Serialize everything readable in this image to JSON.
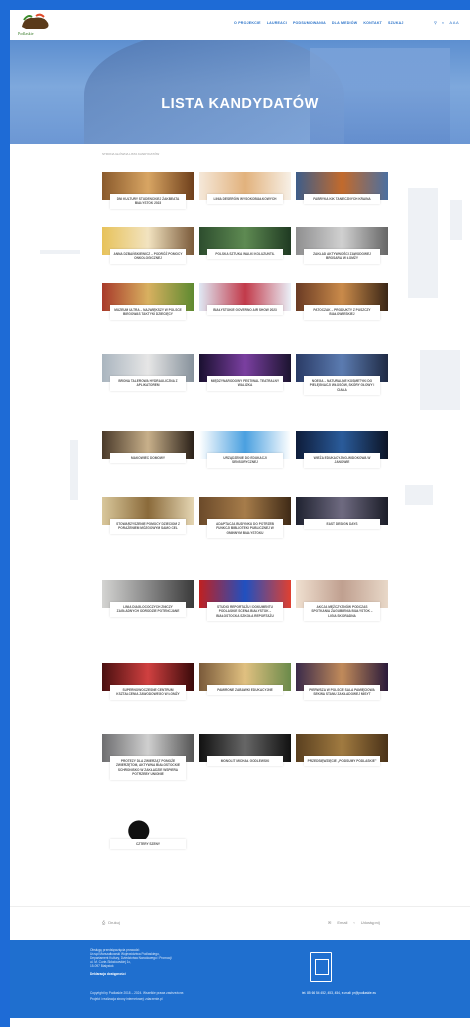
{
  "header": {
    "logo_text": "Podlaskie",
    "nav": [
      "O PROJEKCIE",
      "LAUREACI",
      "PODSUMOWANIA",
      "DLA MEDIÓW",
      "KONTAKT",
      "SZUKAJ"
    ],
    "lang": "A A A"
  },
  "hero": {
    "title": "LISTA KANDYDATÓW"
  },
  "breadcrumb": "STRONA GŁÓWNA   LISTA KANDYDATÓW",
  "cards": [
    "DNI KULTURY STUDENCKIEJ ŻAKBEATA BIAŁYSTOK 2023",
    "LINIA DESERÓW WYSOKOBIAŁKOWYCH",
    "FABRYKA KIK TANECZNYCH KRAINA",
    "ANNA DZBAŃSKIEWICZ – PODRÓŻ POMOCY ONKOLOGICZNEJ",
    "POLSKA SZTUKA WALKI KOLUZUNTIL",
    "ZAKŁAD AKTYWNOŚCI ZAWODOWEJ BROSARA W ŁOMŻY",
    "MUZEUM ULTRA – NAJWIĘKSZY W POLSCE BIEGOWAS TAKTYKI DZIECIĘCY",
    "BIAŁYSTOKIE GOVERNO AIR SHOW 2023",
    "PATOCZAK – PRODUKTY Z PUSZCZY BIAŁOWIESKIEJ",
    "BRONA TALEROWA HYDRAULICZNA Z APLIKATOREM",
    "MIĘDZYNARODOWY FESTIWAL TEATRALNY WALIZKA",
    "NOEGA – NATURALNE KOSMETYKI DO PIELĘGNACJI WŁOSÓW, SKÓRY GŁOWY I CIAŁA",
    "MAKOWIEC DOMOWY",
    "URZĄDZENIE DO EDUKACJI SENSORYCZNEJ",
    "WIEŻA EDUKACYJNO-WIDOKOWA W JANOWIE",
    "STOWARZYSZENIE POMOCY DZIECIOM Z PORAŻENIEM MÓZGOWYM SAMO CEL",
    "ADAPTACJA BUDYNKU DO POTRZEB FUNKCJI BIBLIOTEKI PUBLICZNEJ W GMINNYM BIAŁYSTOKU",
    "EAST DESIGN DAYS",
    "LINIA DIAGLOCOCZYCH ZNICZY ZAGŁADNYCH ODRODZIE POTENCJANE",
    "STUDIO REPORTAŻU I DOKUMENTU PODLASKIE SCENA BIAŁYSTOK – BIAŁOSTOCKA SZKOŁA REPORTAŻU",
    "AKCJA MĘŻCZYZNÓW PODCZAS SPOTKANIA ZAGUBIENIA BIAŁYSTOK – LIGIA SKORADNA",
    "SUPERNOWOCZESNE CENTRUM KSZTAŁCENIA ZAWODOWEGO W ŁOMŻY",
    "PAMIRONE ZABAWKI EDUKACYJNE",
    "PIERWSZA W POLSCE SALA PAMIĘCIOWA SEKWA STANU ZAKŁADOWEJ MISYT",
    "PROTEZY DLA ZWIERZĄT POMOŻE ZWIERZĘTOM, AKTYWNA BIAŁOSTOCKIE SCHRONISKO W ZAKŁADZIE WSPIERA POTRZEBY UNIONIE",
    "MONOLIT MICHAŁ GODLEWSKI",
    "PRZEDSIĘWZIĘCIE „PODSUMY PODLASKIE”",
    "CZTERY SZENY"
  ],
  "share": {
    "print": "Drukuj",
    "email": "Email",
    "share": "Udostępnij"
  },
  "footer": {
    "lines": [
      "Obsługę przedsięwzięcia prowadzi:",
      "Urząd Marszałkowski Województwa Podlaskiego,",
      "Departament Kultury, Dziedzictwa Narodowego i Promocji",
      "ul. M. Curie-Skłodowskiej 1c,",
      "15-097 Białystok"
    ],
    "privacy": "Deklaracja dostępności",
    "copyright": "Copyright by Podlaskie 2018 – 2024. Wszelkie prawa zastrzeżone.",
    "credits": "Projekt i realizacja strony internetowej: zdarzenie.pl",
    "contact": "tel. 85 66 54 452, 453, 454, e-mail: pr@podlaskie.eu"
  },
  "colors": {
    "frame_blue": "#1E6BD6",
    "footer_blue": "#1F6FCF",
    "nav_blue": "#2A72C8"
  }
}
